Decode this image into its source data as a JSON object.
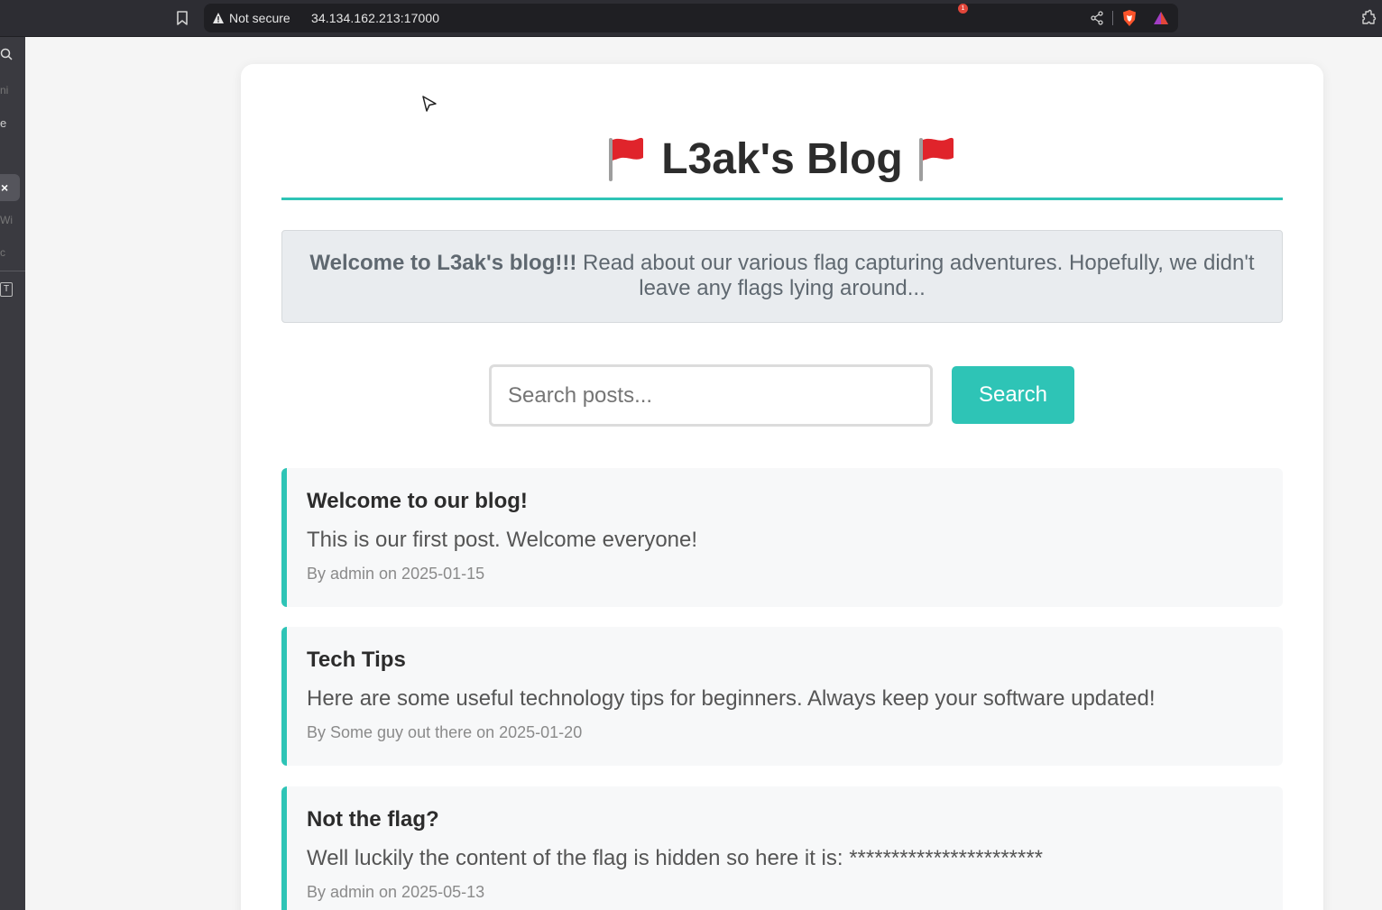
{
  "browser": {
    "security_label": "Not secure",
    "url": "34.134.162.213:17000",
    "rewards_badge": "1"
  },
  "sidebar": {
    "faded_items": [
      "ni",
      "e",
      "Wi",
      "c"
    ],
    "close_label": "×",
    "t_label": "T"
  },
  "page": {
    "title": "L3ak's Blog",
    "welcome_bold": "Welcome to L3ak's blog!!!",
    "welcome_text": " Read about our various flag capturing adventures. Hopefully, we didn't leave any flags lying around...",
    "search": {
      "placeholder": "Search posts...",
      "button_label": "Search"
    },
    "posts": [
      {
        "title": "Welcome to our blog!",
        "content": "This is our first post. Welcome everyone!",
        "meta": "By admin on 2025-01-15"
      },
      {
        "title": "Tech Tips",
        "content": "Here are some useful technology tips for beginners. Always keep your software updated!",
        "meta": "By Some guy out there on 2025-01-20"
      },
      {
        "title": "Not the flag?",
        "content": "Well luckily the content of the flag is hidden so here it is: ***********************",
        "meta": "By admin on 2025-05-13"
      }
    ]
  },
  "colors": {
    "accent": "#2ec4b6",
    "flag_red": "#e0242b"
  }
}
